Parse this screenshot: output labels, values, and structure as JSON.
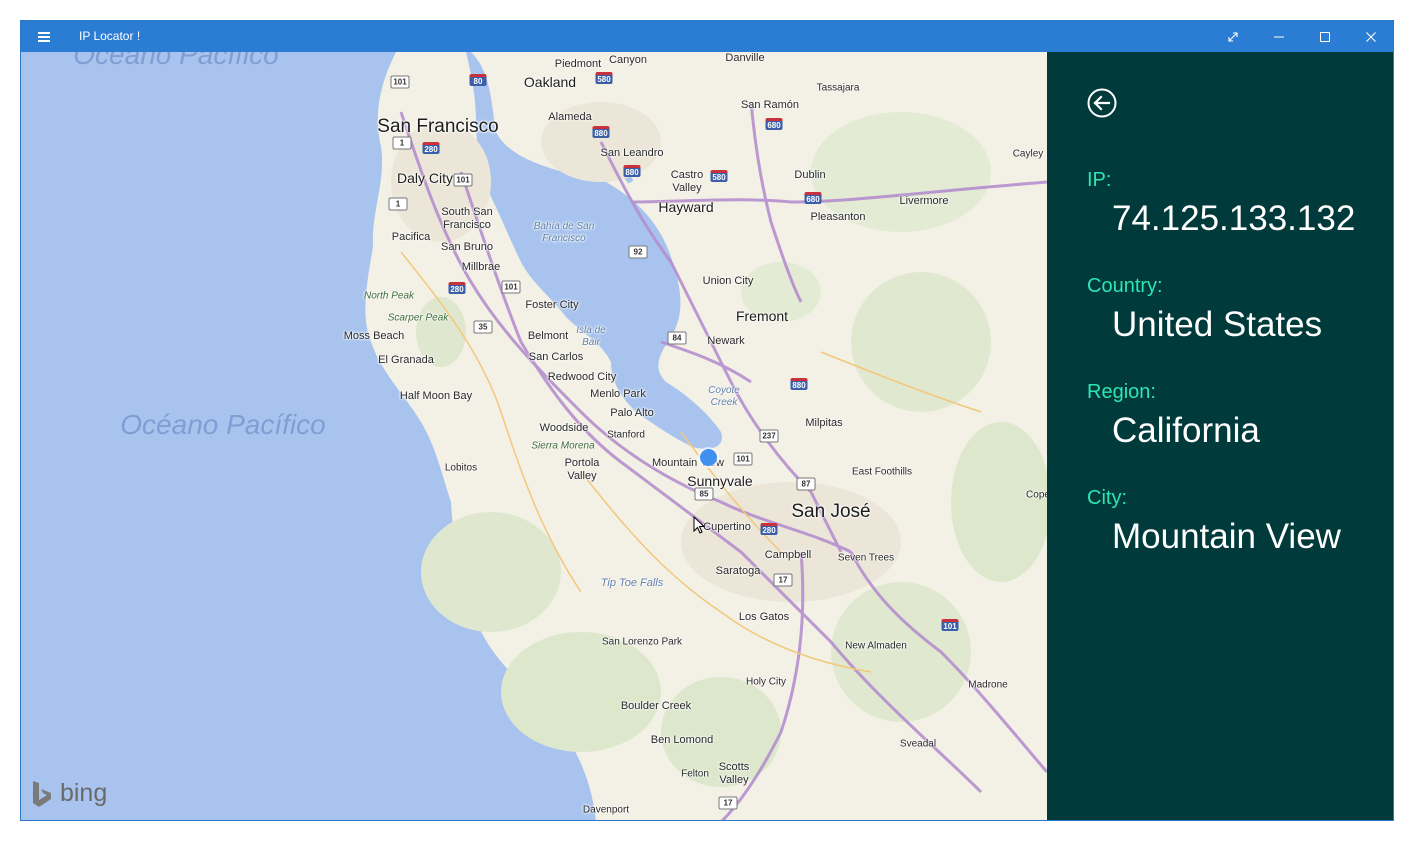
{
  "window": {
    "title": "IP Locator !",
    "controls": {
      "fullscreen": "expand-icon",
      "minimize": "minimize-icon",
      "maximize": "maximize-icon",
      "close": "close-icon"
    }
  },
  "colors": {
    "titlebar": "#2b7cd3",
    "panel_bg": "#003a3a",
    "panel_label": "#2ee6b4",
    "panel_value": "#ffffff",
    "water": "#a8c4ee",
    "land": "#f3f0e6",
    "location_dot": "#3f90f0"
  },
  "map": {
    "provider": "bing",
    "place_labels": {
      "oceano_top": "Océano Pacífico",
      "oceano": "Océano Pacífico",
      "san_francisco": "San Francisco",
      "daly_city": "Daly City",
      "south_san_francisco": "South San Francisco",
      "pacifica": "Pacifica",
      "san_bruno": "San Bruno",
      "millbrae": "Millbrae",
      "north_peak": "North Peak",
      "scarper_peak": "Scarper Peak",
      "moss_beach": "Moss Beach",
      "el_granada": "El Granada",
      "half_moon_bay": "Half Moon Bay",
      "lobitos": "Lobitos",
      "piedmont": "Piedmont",
      "canyon": "Canyon",
      "oakland": "Oakland",
      "alameda": "Alameda",
      "danville": "Danville",
      "tassajara": "Tassajara",
      "san_ramon": "San Ramón",
      "san_leandro": "San Leandro",
      "castro_valley": "Castro Valley",
      "hayward": "Hayward",
      "dublin": "Dublin",
      "pleasanton": "Pleasanton",
      "livermore": "Livermore",
      "cayley": "Cayley",
      "bahia": "Bahía de San Francisco",
      "foster_city": "Foster City",
      "belmont": "Belmont",
      "isla_de_bair": "Isla de Bair",
      "san_carlos": "San Carlos",
      "redwood_city": "Redwood City",
      "menlo_park": "Menlo Park",
      "palo_alto": "Palo Alto",
      "stanford": "Stanford",
      "woodside": "Woodside",
      "sierra_morena": "Sierra Morena",
      "portola_valley": "Portola Valley",
      "union_city": "Union City",
      "fremont": "Fremont",
      "newark": "Newark",
      "coyote_creek": "Coyote Creek",
      "milpitas": "Milpitas",
      "mountain_view": "Mountain View",
      "sunnyvale": "Sunnyvale",
      "east_foothills": "East Foothills",
      "san_jose": "San José",
      "copernicus": "Cope",
      "cupertino": "Cupertino",
      "campbell": "Campbell",
      "seven_trees": "Seven Trees",
      "saratoga": "Saratoga",
      "tip_toe_falls": "Tip Toe Falls",
      "los_gatos": "Los Gatos",
      "san_lorenzo_park": "San Lorenzo Park",
      "new_almaden": "New Almaden",
      "holy_city": "Holy City",
      "madrone": "Madrone",
      "boulder_creek": "Boulder Creek",
      "ben_lomond": "Ben Lomond",
      "sveadal": "Sveadal",
      "felton": "Felton",
      "scotts_valley": "Scotts Valley",
      "davenport": "Davenport"
    },
    "shields": [
      "101",
      "80",
      "1",
      "280",
      "101",
      "1",
      "101",
      "280",
      "35",
      "580",
      "880",
      "680",
      "880",
      "580",
      "680",
      "92",
      "84",
      "880",
      "237",
      "101",
      "87",
      "85",
      "280",
      "17",
      "101",
      "17"
    ],
    "bing_text": "bing"
  },
  "panel": {
    "back_icon": "back-arrow-icon",
    "ip_label": "IP:",
    "ip_value": "74.125.133.132",
    "country_label": "Country:",
    "country_value": "United States",
    "region_label": "Region:",
    "region_value": "California",
    "city_label": "City:",
    "city_value": "Mountain View"
  }
}
